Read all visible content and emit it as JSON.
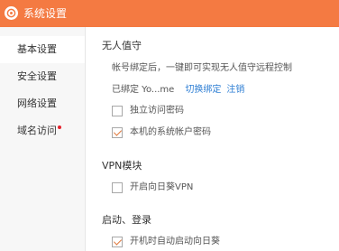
{
  "window": {
    "title": "系统设置",
    "accent_color": "#f47a42",
    "logo_icon": "app-logo-icon"
  },
  "sidebar": {
    "items": [
      {
        "label": "基本设置",
        "active": true
      },
      {
        "label": "安全设置",
        "active": false
      },
      {
        "label": "网络设置",
        "active": false
      },
      {
        "label": "域名访问",
        "active": false,
        "badge_dot": true,
        "badge_color": "#e5212c"
      }
    ]
  },
  "content": {
    "unattended": {
      "title": "无人值守",
      "description": "帐号绑定后，一键即可实现无人值守远程控制",
      "bound_label": "已绑定 Yo...me",
      "switch_link": "切换绑定",
      "logout_link": "注销",
      "options": [
        {
          "label": "独立访问密码",
          "checked": false
        },
        {
          "label": "本机的系统帐户密码",
          "checked": true
        }
      ]
    },
    "vpn": {
      "title": "VPN模块",
      "options": [
        {
          "label": "开启向日葵VPN",
          "checked": false
        }
      ]
    },
    "startup": {
      "title": "启动、登录",
      "options": [
        {
          "label": "开机时自动启动向日葵",
          "checked": true
        }
      ]
    }
  }
}
